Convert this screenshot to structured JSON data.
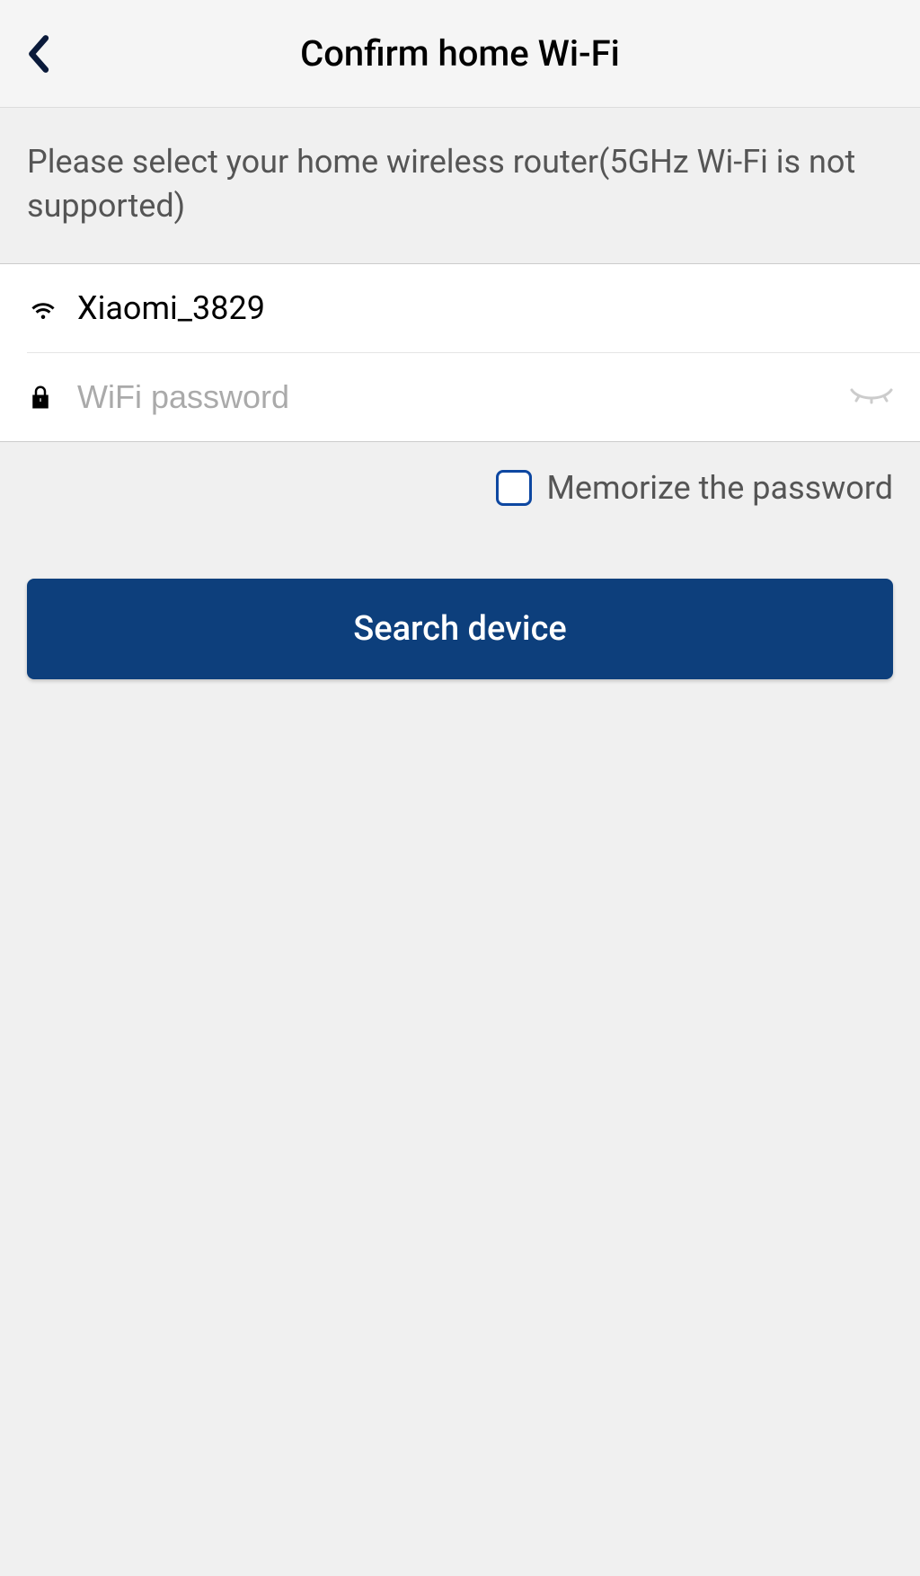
{
  "header": {
    "title": "Confirm home Wi-Fi"
  },
  "instruction": "Please select your home wireless router(5GHz Wi-Fi is not supported)",
  "wifi": {
    "ssid": "Xiaomi_3829",
    "password_placeholder": "WiFi password",
    "password_value": ""
  },
  "memorize": {
    "label": "Memorize the password",
    "checked": false
  },
  "button": {
    "search_label": "Search device"
  }
}
